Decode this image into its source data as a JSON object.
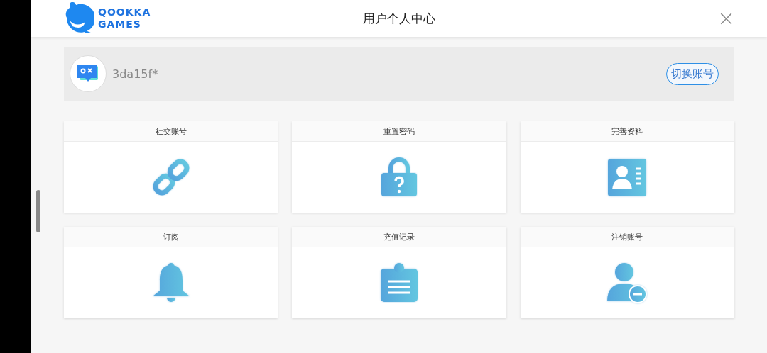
{
  "header": {
    "logo_lines": [
      "QOOKKA",
      "GAMES"
    ],
    "title": "用户个人中心",
    "close": "×"
  },
  "account": {
    "username": "3da15f*",
    "switch_button": "切换账号"
  },
  "cards": [
    {
      "label": "社交账号",
      "kind": "link"
    },
    {
      "label": "重置密码",
      "kind": "lock"
    },
    {
      "label": "完善资料",
      "kind": "profile"
    },
    {
      "label": "订阅",
      "kind": "bell"
    },
    {
      "label": "充值记录",
      "kind": "clipboard"
    },
    {
      "label": "注销账号",
      "kind": "unregister"
    }
  ]
}
